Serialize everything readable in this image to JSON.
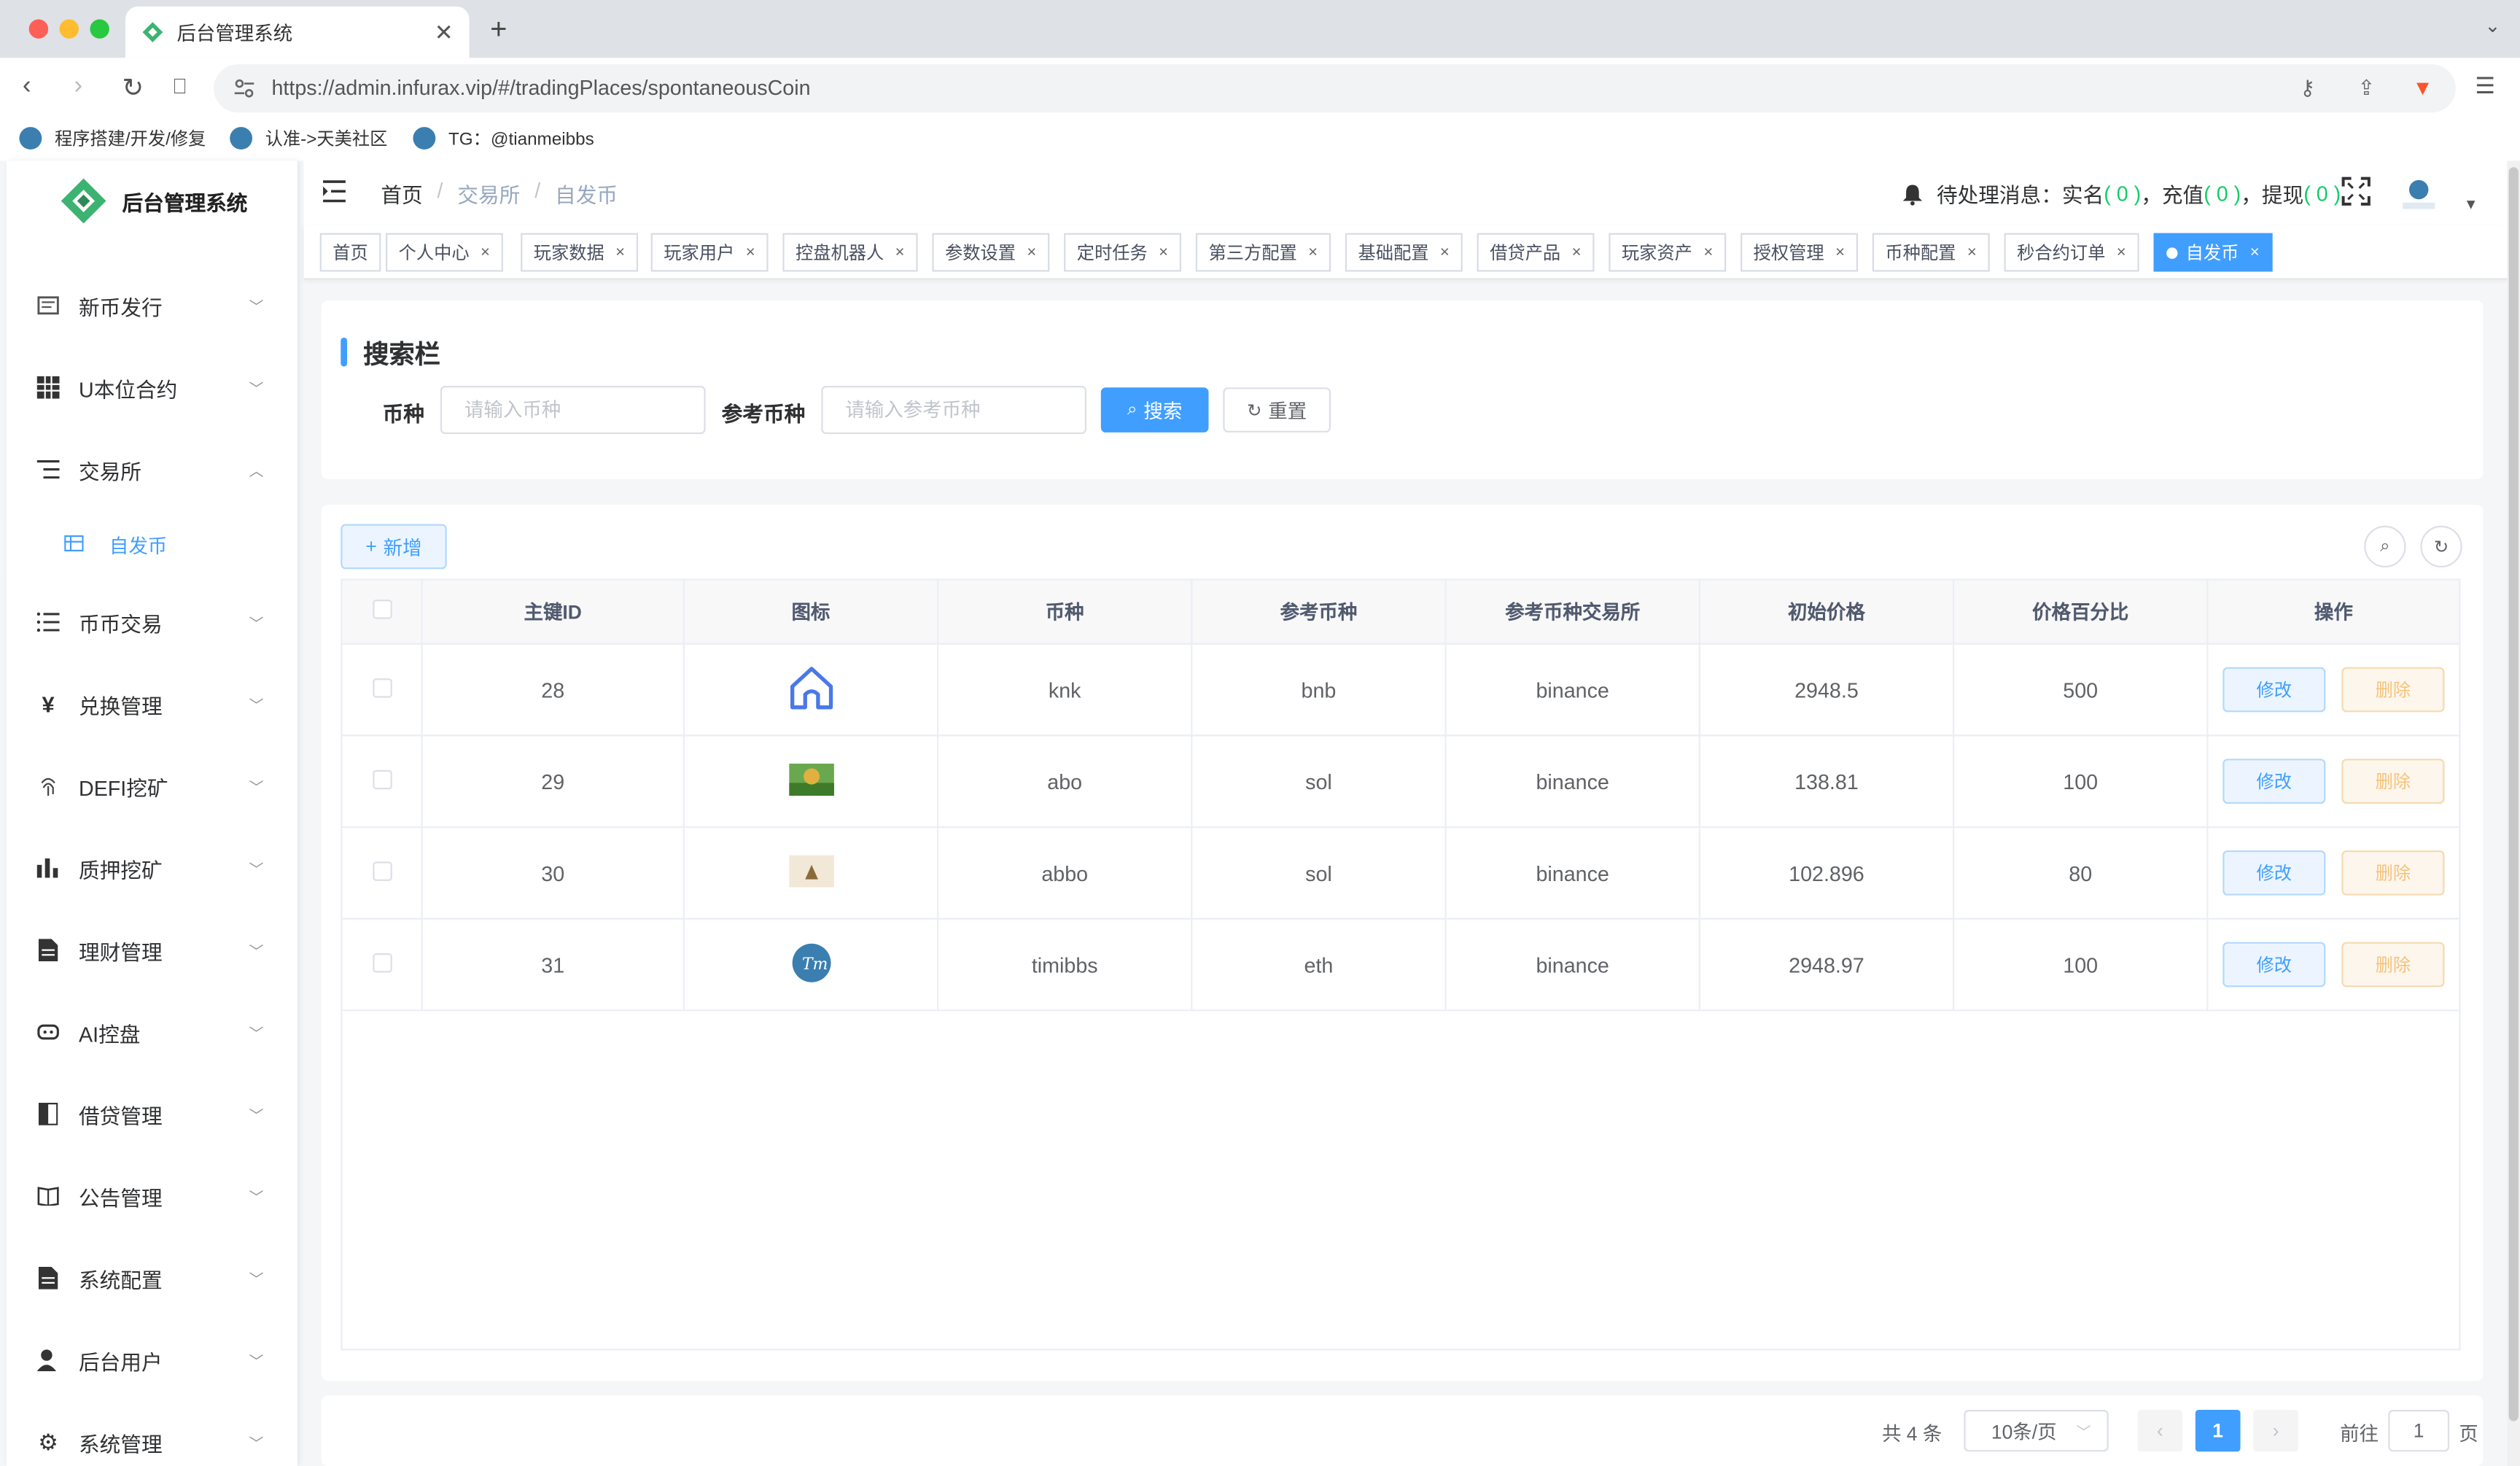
{
  "browser": {
    "tab_title": "后台管理系统",
    "url": "https://admin.infurax.vip/#/tradingPlaces/spontaneousCoin",
    "bookmarks": [
      {
        "label": "程序搭建/开发/修复"
      },
      {
        "label": "认准->天美社区"
      },
      {
        "label": "TG：@tianmeibbs"
      }
    ]
  },
  "sidebar": {
    "logo_text": "后台管理系统",
    "items": [
      {
        "label": "新币发行",
        "icon": "coin-icon"
      },
      {
        "label": "U本位合约",
        "icon": "grid-icon"
      },
      {
        "label": "交易所",
        "icon": "list-icon",
        "expanded": true
      },
      {
        "label": "币币交易",
        "icon": "list-icon"
      },
      {
        "label": "兑换管理",
        "icon": "yen-icon"
      },
      {
        "label": "DEFI挖矿",
        "icon": "fingerprint-icon"
      },
      {
        "label": "质押挖矿",
        "icon": "bar-chart-icon"
      },
      {
        "label": "理财管理",
        "icon": "document-icon"
      },
      {
        "label": "AI控盘",
        "icon": "robot-icon"
      },
      {
        "label": "借贷管理",
        "icon": "book-icon"
      },
      {
        "label": "公告管理",
        "icon": "open-book-icon"
      },
      {
        "label": "系统配置",
        "icon": "document-icon"
      },
      {
        "label": "后台用户",
        "icon": "user-icon"
      },
      {
        "label": "系统管理",
        "icon": "gear-icon"
      }
    ],
    "sub_item": {
      "label": "自发币",
      "icon": "table-icon"
    }
  },
  "navbar": {
    "breadcrumb": [
      "首页",
      "交易所",
      "自发币"
    ],
    "notice_prefix": "待处理消息：",
    "notice_items": [
      {
        "label": "实名",
        "count": "( 0 )",
        "sep": "，"
      },
      {
        "label": "充值",
        "count": "( 0 )",
        "sep": "，"
      },
      {
        "label": "提现",
        "count": "( 0 )",
        "sep": ""
      }
    ]
  },
  "tags": [
    {
      "label": "首页",
      "closable": false,
      "active": false
    },
    {
      "label": "个人中心",
      "closable": true,
      "active": false
    },
    {
      "label": "玩家数据",
      "closable": true,
      "active": false
    },
    {
      "label": "玩家用户",
      "closable": true,
      "active": false
    },
    {
      "label": "控盘机器人",
      "closable": true,
      "active": false
    },
    {
      "label": "参数设置",
      "closable": true,
      "active": false
    },
    {
      "label": "定时任务",
      "closable": true,
      "active": false
    },
    {
      "label": "第三方配置",
      "closable": true,
      "active": false
    },
    {
      "label": "基础配置",
      "closable": true,
      "active": false
    },
    {
      "label": "借贷产品",
      "closable": true,
      "active": false
    },
    {
      "label": "玩家资产",
      "closable": true,
      "active": false
    },
    {
      "label": "授权管理",
      "closable": true,
      "active": false
    },
    {
      "label": "币种配置",
      "closable": true,
      "active": false
    },
    {
      "label": "秒合约订单",
      "closable": true,
      "active": false
    },
    {
      "label": "自发币",
      "closable": true,
      "active": true
    }
  ],
  "search": {
    "title": "搜索栏",
    "coin_label": "币种",
    "coin_placeholder": "请输入币种",
    "ref_label": "参考币种",
    "ref_placeholder": "请输入参考币种",
    "search_btn": "搜索",
    "reset_btn": "重置"
  },
  "table": {
    "add_btn": "新增",
    "columns": [
      "主键ID",
      "图标",
      "币种",
      "参考币种",
      "参考币种交易所",
      "初始价格",
      "价格百分比",
      "操作"
    ],
    "rows": [
      {
        "id": "28",
        "icon": "house-icon",
        "coin": "knk",
        "ref": "bnb",
        "exchange": "binance",
        "price": "2948.5",
        "percent": "500"
      },
      {
        "id": "29",
        "icon": "landscape-thumbnail",
        "coin": "abo",
        "ref": "sol",
        "exchange": "binance",
        "price": "138.81",
        "percent": "100"
      },
      {
        "id": "30",
        "icon": "small-thumbnail",
        "coin": "abbo",
        "ref": "sol",
        "exchange": "binance",
        "price": "102.896",
        "percent": "80"
      },
      {
        "id": "31",
        "icon": "tm-logo",
        "coin": "timibbs",
        "ref": "eth",
        "exchange": "binance",
        "price": "2948.97",
        "percent": "100"
      }
    ],
    "edit_label": "修改",
    "delete_label": "删除"
  },
  "pagination": {
    "total": "共 4 条",
    "page_size": "10条/页",
    "current": "1",
    "goto_prefix": "前往",
    "goto_value": "1",
    "goto_suffix": "页"
  },
  "colors": {
    "primary": "#409eff",
    "success": "#13ce66",
    "warning_plain": "#fdf6ec"
  }
}
